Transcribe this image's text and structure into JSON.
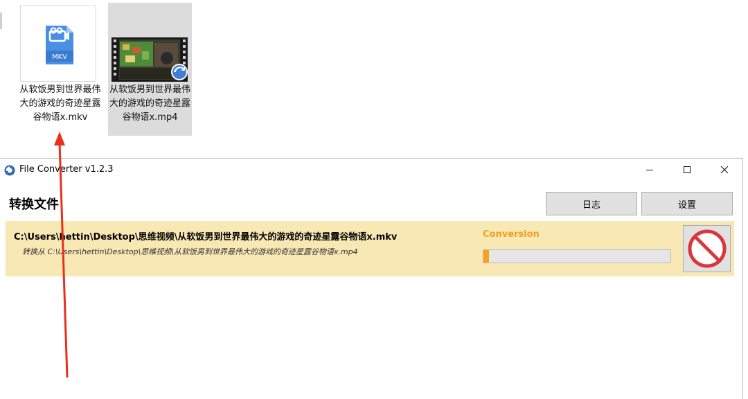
{
  "desktop": {
    "items": [
      {
        "name": "从软饭男到世界最伟大的游戏的奇迹星露谷物语x.mkv",
        "badge": "MKV",
        "icon": "video-file-icon"
      },
      {
        "name": "从软饭男到世界最伟大的游戏的奇迹星露谷物语x.mp4",
        "icon": "video-thumbnail"
      }
    ]
  },
  "window": {
    "title": "File Converter v1.2.3",
    "icon": "file-converter-app-icon",
    "controls": [
      "minimize-icon",
      "maximize-icon",
      "close-icon"
    ]
  },
  "header": {
    "title": "转换文件",
    "log_label": "日志",
    "settings_label": "设置"
  },
  "job": {
    "output_path": "C:\\Users\\hettin\\Desktop\\思维视频\\从软饭男到世界最伟大的游戏的奇迹星露谷物语x.mkv",
    "source_text": "转换从  C:\\Users\\hettin\\Desktop\\思维视频\\从软饭男到世界最伟大的游戏的奇迹星露谷物语x.mp4",
    "state": "Conversion",
    "progress_percent": 3,
    "cancel_icon": "cancel-prohibited-icon"
  },
  "colors": {
    "job_background": "#f8e8b4",
    "progress_accent": "#f7a21a",
    "state_text": "#f0a020",
    "cancel_red": "#d9363e",
    "annotation_arrow": "#e8301c",
    "mkv_icon_blue": "#4a90e2"
  }
}
